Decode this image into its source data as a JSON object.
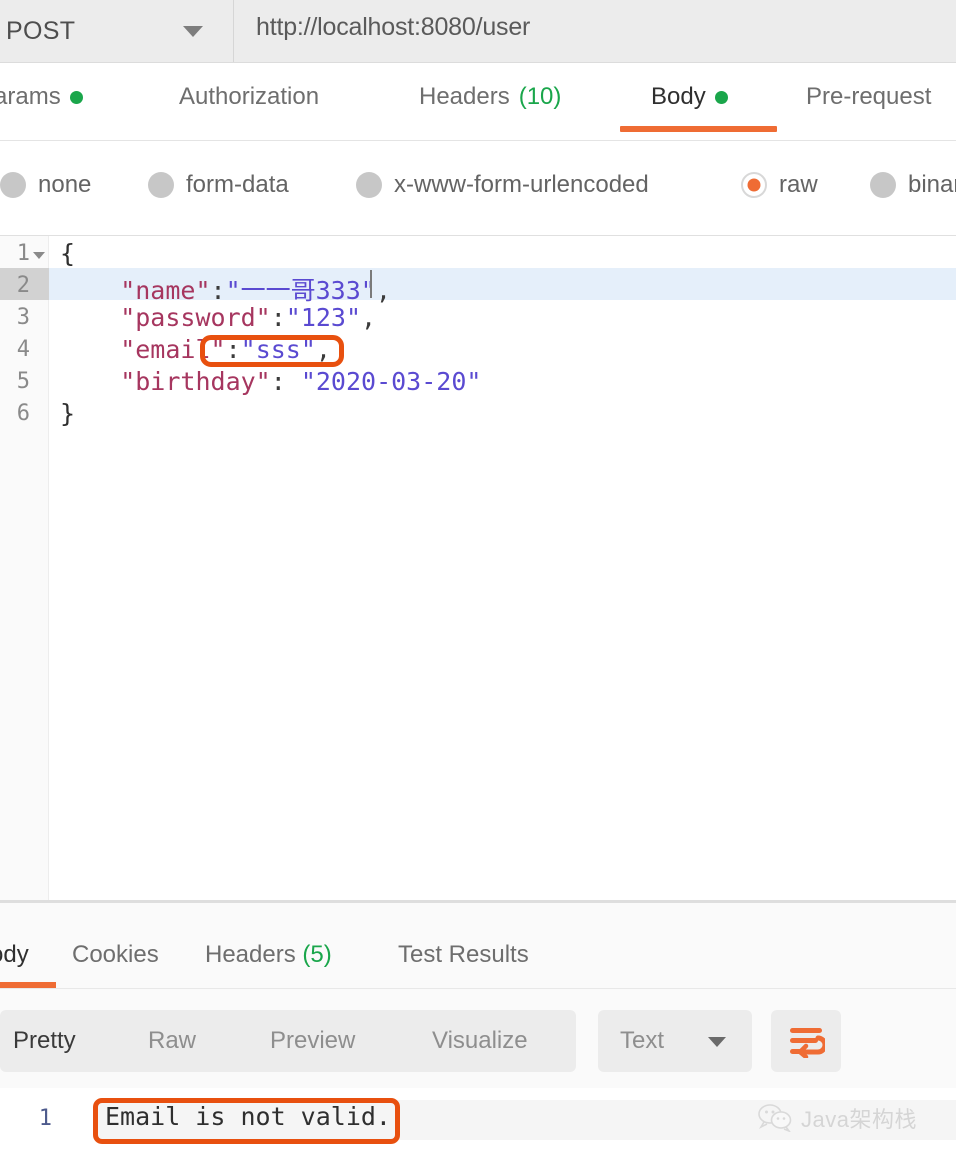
{
  "request": {
    "method": "POST",
    "url": "http://localhost:8080/user",
    "tabs": [
      {
        "label": "Params",
        "dot": true,
        "active": false
      },
      {
        "label": "Authorization",
        "dot": false,
        "active": false
      },
      {
        "label": "Headers",
        "count": "(10)",
        "active": false
      },
      {
        "label": "Body",
        "dot": true,
        "active": true
      },
      {
        "label": "Pre-request",
        "dot": false,
        "active": false
      }
    ],
    "body_types": [
      {
        "label": "none",
        "selected": false
      },
      {
        "label": "form-data",
        "selected": false
      },
      {
        "label": "x-www-form-urlencoded",
        "selected": false
      },
      {
        "label": "raw",
        "selected": true
      },
      {
        "label": "binary",
        "selected": false
      }
    ],
    "editor": {
      "lines": [
        {
          "num": "1",
          "fold": true,
          "highlight": false,
          "text": "{"
        },
        {
          "num": "2",
          "fold": false,
          "highlight": true,
          "text": "    \"name\":\"一一哥333\","
        },
        {
          "num": "3",
          "fold": false,
          "highlight": false,
          "text": "    \"password\":\"123\","
        },
        {
          "num": "4",
          "fold": false,
          "highlight": false,
          "text": "    \"email\":\"sss\","
        },
        {
          "num": "5",
          "fold": false,
          "highlight": false,
          "text": "    \"birthday\": \"2020-03-20\""
        },
        {
          "num": "6",
          "fold": false,
          "highlight": false,
          "text": "}"
        }
      ],
      "cursor_line": "2"
    }
  },
  "response": {
    "tabs": [
      {
        "label": "ody",
        "active": true
      },
      {
        "label": "Cookies",
        "active": false
      },
      {
        "label": "Headers",
        "count": "(5)",
        "active": false
      },
      {
        "label": "Test Results",
        "active": false
      }
    ],
    "view_modes": [
      {
        "label": "Pretty",
        "active": true
      },
      {
        "label": "Raw",
        "active": false
      },
      {
        "label": "Preview",
        "active": false
      },
      {
        "label": "Visualize",
        "active": false
      }
    ],
    "format": {
      "label": "Text"
    },
    "wrap_button": "word-wrap-icon",
    "body": {
      "line_number": "1",
      "text": "Email is not valid."
    }
  },
  "watermark": {
    "text": "Java架构栈"
  },
  "colors": {
    "accent_orange": "#ef6c34",
    "highlight_orange": "#e8500f",
    "dot_green": "#1aa64b",
    "json_key": "#a6365f",
    "json_string": "#5a4ad1",
    "row_highlight": "#e5effa"
  }
}
